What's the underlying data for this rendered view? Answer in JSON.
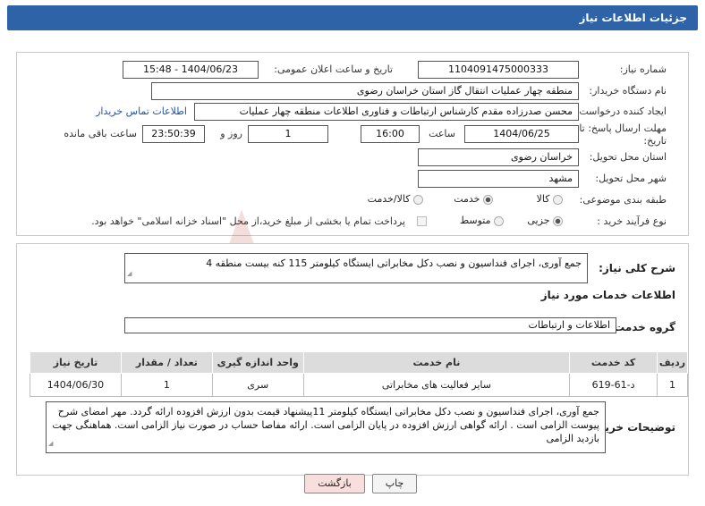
{
  "header": {
    "title": "جزئیات اطلاعات نیاز"
  },
  "form": {
    "need_number_label": "شماره نیاز:",
    "need_number": "1104091475000333",
    "announce_label": "تاریخ و ساعت اعلان عمومی:",
    "announce_value": "1404/06/23 - 15:48",
    "buyer_org_label": "نام دستگاه خریدار:",
    "buyer_org": "منطقه چهار عملیات انتقال گاز    استان خراسان رضوی",
    "requester_label": "ایجاد کننده درخواست:",
    "requester": "محسن صدرزاده مقدم کارشناس ارتباطات و فناوری اطلاعات منطقه چهار عملیات",
    "contact_link": "اطلاعات تماس خریدار",
    "deadline_label_1": "مهلت ارسال پاسخ: تا",
    "deadline_label_2": "تاریخ:",
    "deadline_date": "1404/06/25",
    "time_label": "ساعت",
    "deadline_time": "16:00",
    "days_value": "1",
    "days_label": "روز و",
    "remaining_time": "23:50:39",
    "remaining_label": "ساعت باقی مانده",
    "province_label": "استان محل تحویل:",
    "province": "خراسان رضوی",
    "city_label": "شهر محل تحویل:",
    "city": "مشهد",
    "category_label": "طبقه بندی موضوعی:",
    "category_options": [
      "کالا",
      "خدمت",
      "کالا/خدمت"
    ],
    "category_selected": "خدمت",
    "process_label": "نوع فرآیند خرید :",
    "process_options": [
      "جزیی",
      "متوسط"
    ],
    "process_selected": "جزیی",
    "payment_note": "پرداخت تمام یا بخشی از مبلغ خرید،از محل \"اسناد خزانه اسلامی\" خواهد بود."
  },
  "summary": {
    "label": "شرح کلی نیاز:",
    "text": "جمع آوری، اجرای فنداسیون و نصب دکل مخابراتی ایستگاه کیلومتر 115 کنه بیست منطقه 4"
  },
  "services": {
    "section_title": "اطلاعات خدمات مورد نیاز",
    "group_label": "گروه خدمت:",
    "group_value": "اطلاعات و ارتباطات",
    "columns": [
      "ردیف",
      "کد خدمت",
      "نام خدمت",
      "واحد اندازه گیری",
      "تعداد / مقدار",
      "تاریخ نیاز"
    ],
    "rows": [
      {
        "index": "1",
        "code": "د-61-619",
        "name": "سایر فعالیت های مخابراتی",
        "unit": "سری",
        "qty": "1",
        "date": "1404/06/30"
      }
    ]
  },
  "buyer_notes": {
    "label": "توضیحات خریدار:",
    "text": "جمع آوری، اجرای فنداسیون و نصب دکل مخابراتی ایستگاه کیلومتر 11پیشنهاد قیمت بدون ارزش افزوده ارائه گردد. مهر امضای شرح پیوست الزامی است . ارائه گواهی ارزش افزوده در پایان الزامی است. ارائه مفاصا حساب در صورت نیاز الزامی است. هماهنگی جهت بازدید الزامی"
  },
  "buttons": {
    "print": "چاپ",
    "back": "بازگشت"
  },
  "colors": {
    "header": "#2e63a8",
    "back_button": "#f9dede",
    "watermark": "#c0392b"
  }
}
